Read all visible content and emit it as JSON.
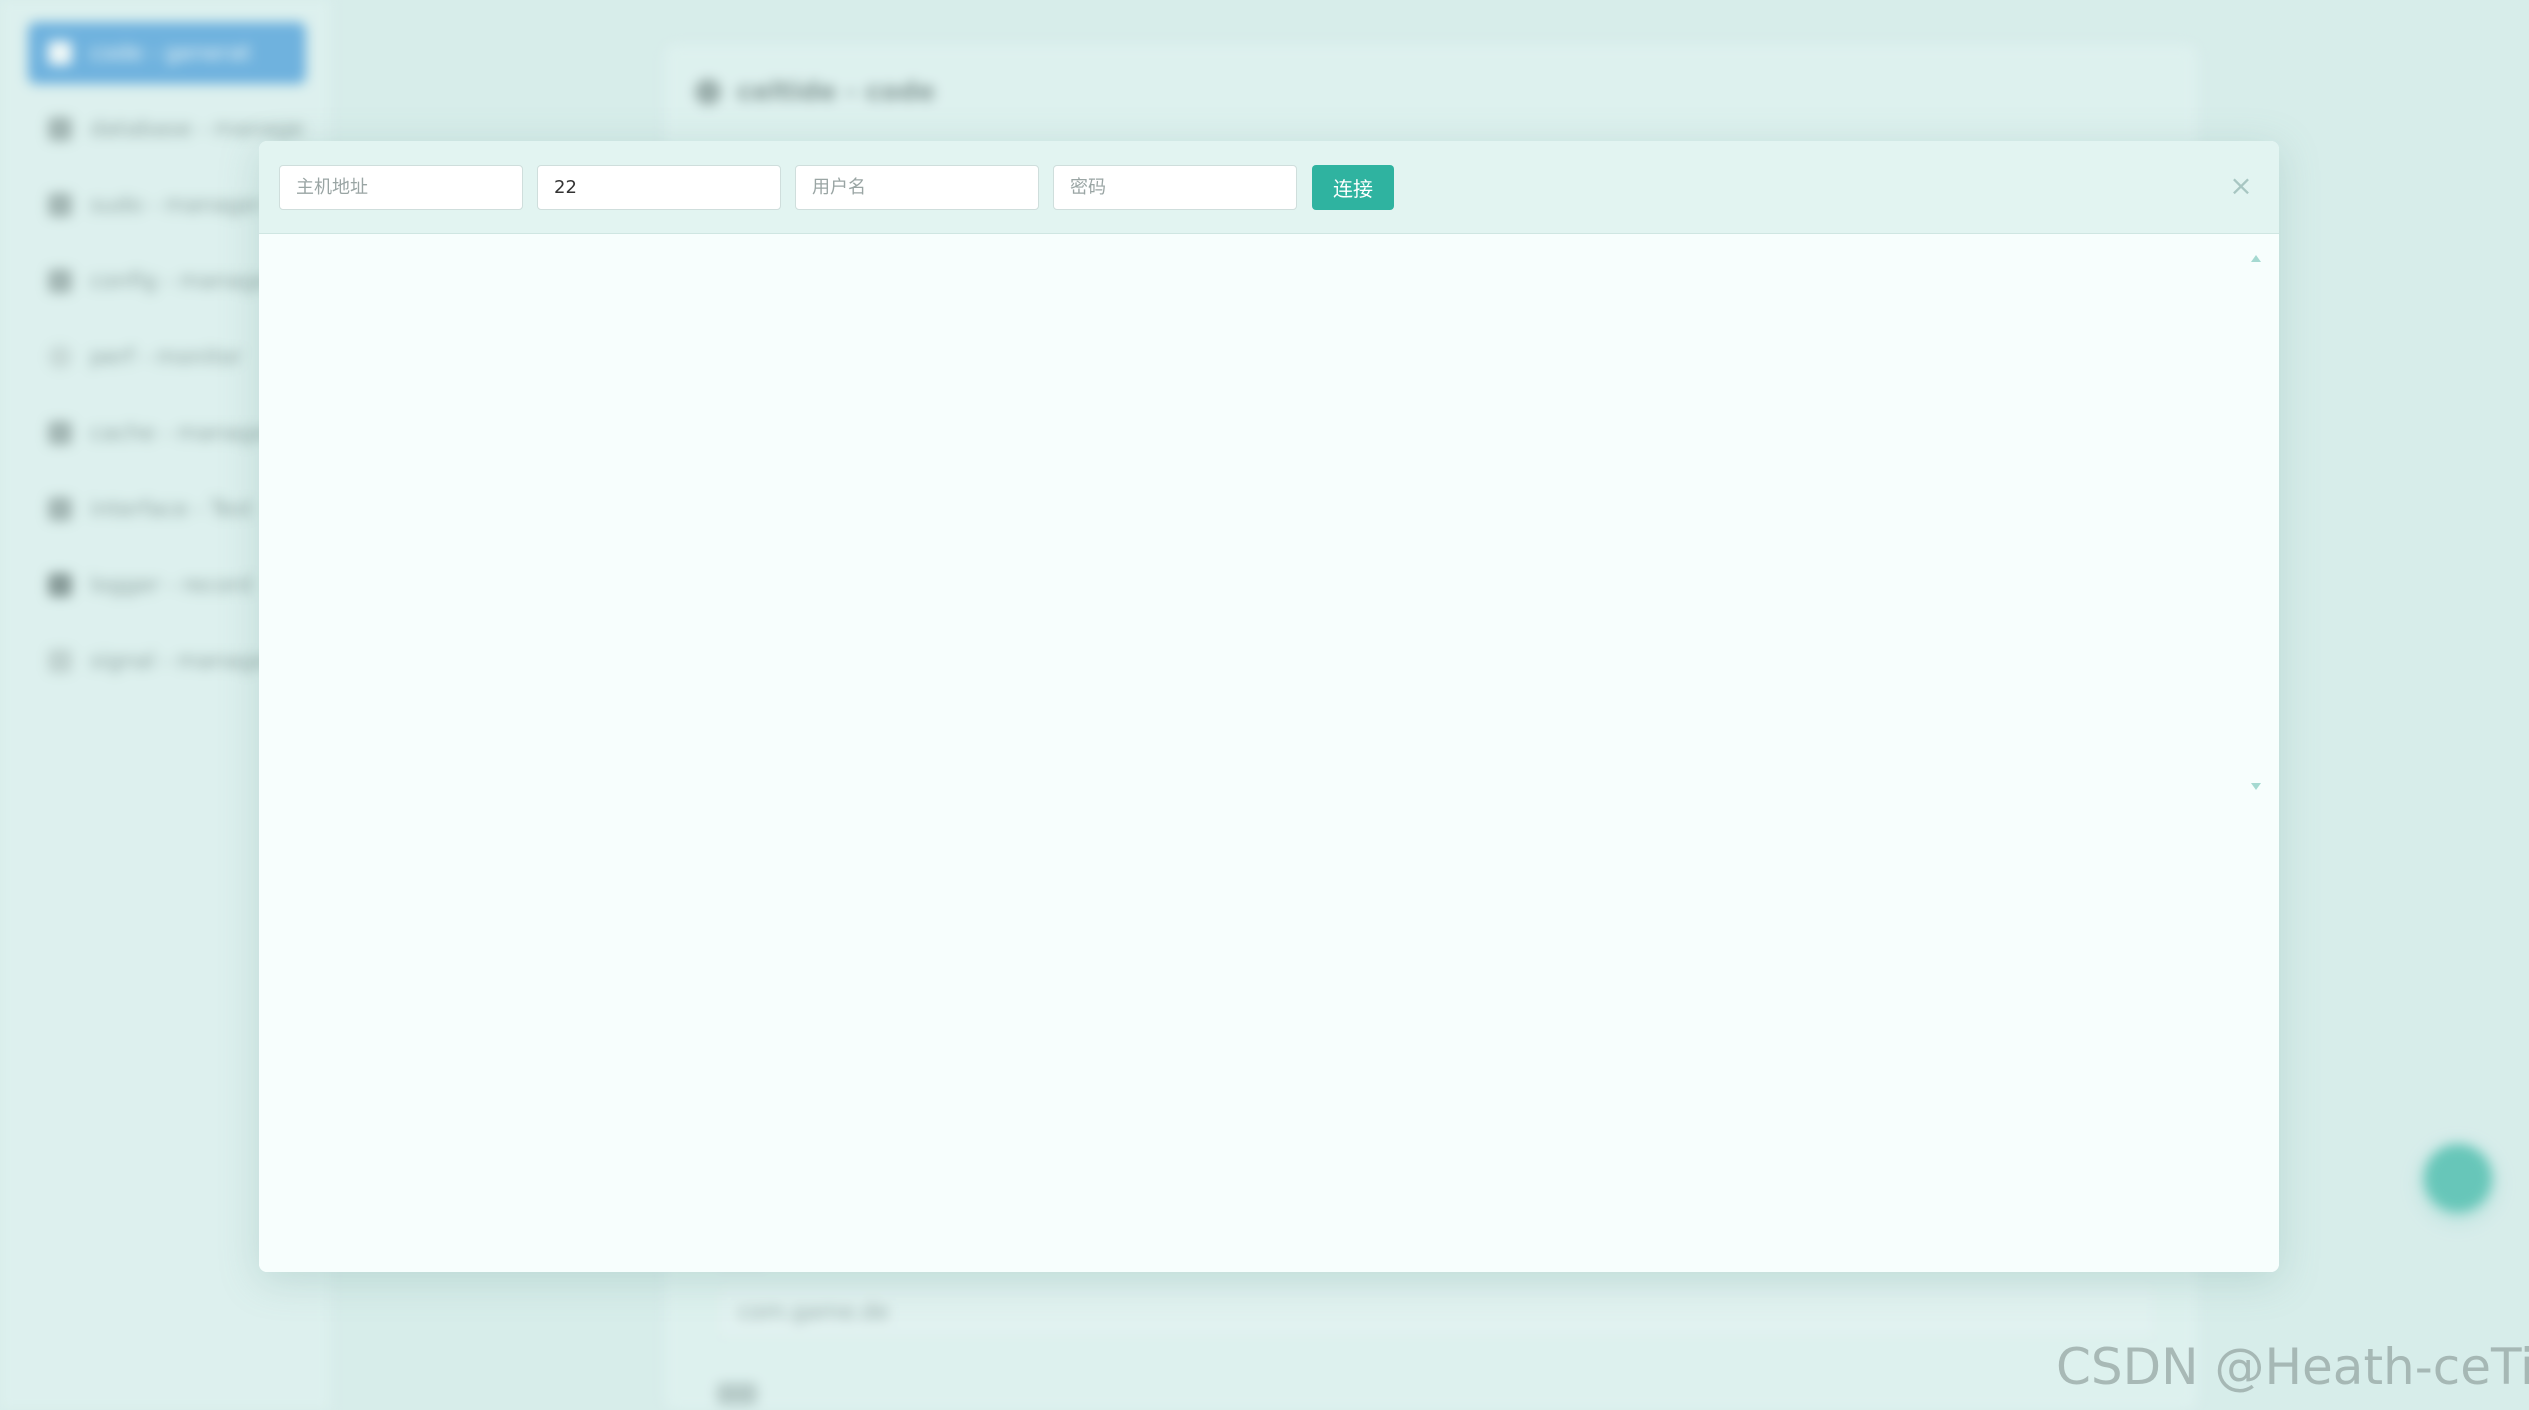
{
  "background": {
    "sidebar": {
      "items": [
        {
          "label": "code - generat",
          "active": true
        },
        {
          "label": "database - manage",
          "active": false
        },
        {
          "label": "sudo - manager",
          "active": false
        },
        {
          "label": "config - manage",
          "active": false
        },
        {
          "label": "perf - monitor",
          "active": false
        },
        {
          "label": "cache - manager",
          "active": false
        },
        {
          "label": "interface - Test",
          "active": false
        },
        {
          "label": "logger - record",
          "active": false
        },
        {
          "label": "signal - manager",
          "active": false
        }
      ]
    },
    "main": {
      "title": "celtide - code",
      "field_value": "com.game.de"
    }
  },
  "ssh_dialog": {
    "host": {
      "placeholder": "主机地址",
      "value": ""
    },
    "port": {
      "placeholder": "",
      "value": "22"
    },
    "username": {
      "placeholder": "用户名",
      "value": ""
    },
    "password": {
      "placeholder": "密码",
      "value": ""
    },
    "connect_label": "连接",
    "close_symbol": "×"
  },
  "watermark": "CSDN @Heath-ceTide",
  "colors": {
    "accent": "#2fb3a0",
    "sidebar_active": "#3b94d9",
    "header_bg": "#e2f4f1",
    "terminal_bg": "#f7fefd"
  }
}
